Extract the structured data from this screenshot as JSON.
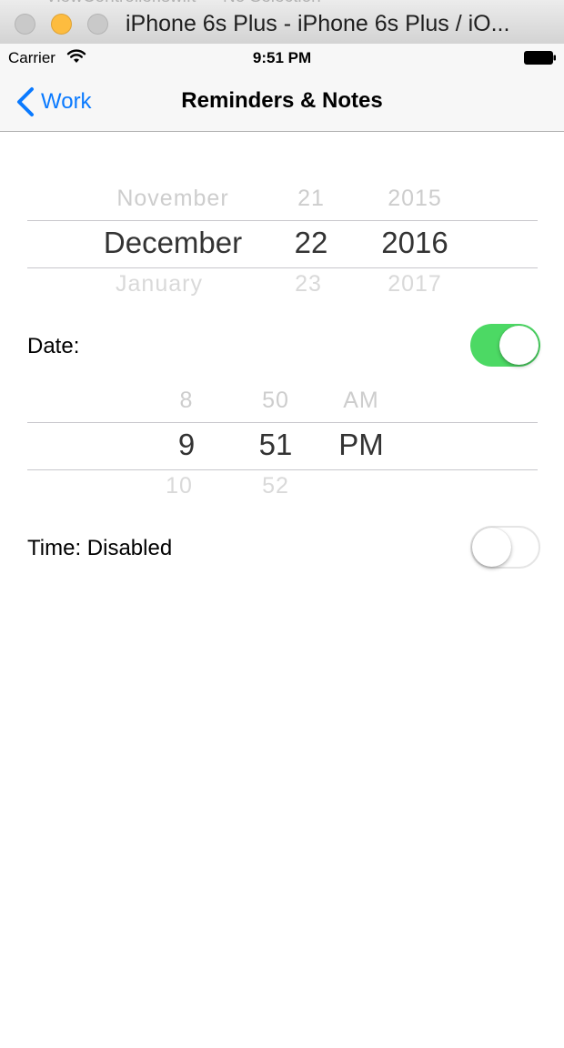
{
  "window": {
    "ghost_title": "ViewController.swift — No Selection",
    "title": "iPhone 6s Plus - iPhone 6s Plus / iO..."
  },
  "status_bar": {
    "carrier": "Carrier",
    "time": "9:51 PM"
  },
  "nav": {
    "back_label": "Work",
    "title": "Reminders & Notes"
  },
  "date_picker": {
    "month": {
      "prev": "November",
      "selected": "December",
      "next": "January"
    },
    "day": {
      "prev": "21",
      "selected": "22",
      "next": "23"
    },
    "year": {
      "prev": "2015",
      "selected": "2016",
      "next": "2017"
    }
  },
  "date_row": {
    "label": "Date:",
    "switch_on": true
  },
  "time_picker": {
    "hour": {
      "prev": "8",
      "selected": "9",
      "next": "10"
    },
    "minute": {
      "prev": "50",
      "selected": "51",
      "next": "52"
    },
    "period": {
      "prev": "AM",
      "selected": "PM",
      "next": ""
    }
  },
  "time_row": {
    "label": "Time: Disabled",
    "switch_on": false
  },
  "colors": {
    "tint": "#0a7aff",
    "switch_on": "#4cd964",
    "traffic_minimize": "#fdbc3f"
  },
  "icons": {
    "back": "chevron-left-icon",
    "wifi": "wifi-icon",
    "battery": "battery-icon"
  }
}
